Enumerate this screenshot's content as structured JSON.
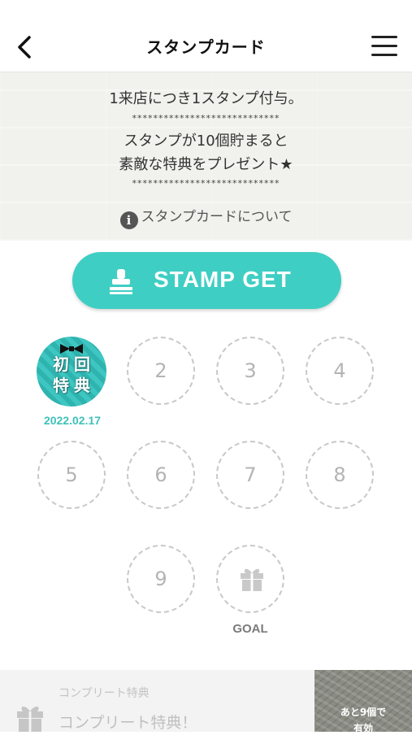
{
  "header": {
    "title": "スタンプカード"
  },
  "info": {
    "line1": "1来店につき1スタンプ付与。",
    "stars1": "****************************",
    "line2": "スタンプが10個貯まると",
    "line3": "素敵な特典をプレゼント★",
    "stars2": "****************************",
    "about_label": "スタンプカードについて",
    "about_icon": "i"
  },
  "stamp_button": {
    "label": "STAMP GET"
  },
  "stamps": {
    "first": {
      "char1": "初",
      "char2": "回",
      "char3": "特",
      "char4": "典",
      "date": "2022.02.17"
    },
    "slots": [
      "2",
      "3",
      "4",
      "5",
      "6",
      "7",
      "8",
      "9"
    ],
    "goal_label": "GOAL"
  },
  "complete": {
    "caption": "コンプリート特典",
    "title": "コンプリート特典！",
    "remaining_line1": "あと9個で",
    "remaining_line2": "有効"
  },
  "colors": {
    "accent": "#3fcec3",
    "date": "#3fc1b9",
    "slot_border": "#c8c8c8"
  }
}
